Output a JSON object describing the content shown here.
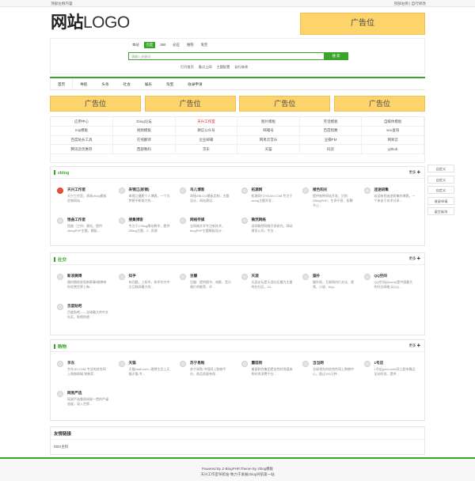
{
  "topbar": {
    "left": "顶部左侧内容",
    "right": "顶部右侧 | 自行修改"
  },
  "logo": {
    "cn": "网站",
    "en": "LOGO"
  },
  "ad_top": "广告位",
  "search": {
    "tabs": [
      "本站",
      "百度",
      "360",
      "必应",
      "搜狗",
      "淘宝"
    ],
    "active_tab": 1,
    "placeholder": "请输入关键词",
    "button": "搜 索",
    "hot": [
      "打开首页",
      "看点上网",
      "主题配置",
      "自行修改"
    ]
  },
  "nav": [
    "首页",
    "导航",
    "头条",
    "社会",
    "娱乐",
    "淘宝",
    "收录申请"
  ],
  "ads_row": [
    "广告位",
    "广告位",
    "广告位",
    "广告位"
  ],
  "links": [
    [
      "应用中心",
      "zblog论坛",
      "天兴工作室",
      "图片模板",
      "笑话模板",
      "自媒体模板"
    ],
    [
      "mip模板",
      "视频模板",
      "微信公众号",
      "邮箱号",
      "百度指数",
      "seo查询"
    ],
    [
      "百度站长工具",
      "在线翻译",
      "企业邮箱",
      "网易云音乐",
      "豆瓣FM",
      "网易云"
    ],
    [
      "腾讯云优惠券",
      "西部数码",
      "京东",
      "天猫",
      "码云",
      "github"
    ]
  ],
  "sidebar": [
    "自定义",
    "自定义",
    "自定义",
    "收录申请",
    "留言板块"
  ],
  "categories": [
    {
      "title": "zblog",
      "more": "更多 ✚",
      "items": [
        {
          "name": "天兴工作室",
          "desc": "天兴工作室，承接zblog模板定制网站..."
        },
        {
          "name": "来锦江(彩钢)",
          "desc": "来锦江摄影个人博客，一个为梦想不断努力的..."
        },
        {
          "name": "鸟儿博客",
          "desc": "承接ZBLOG模板定制，主题设计，网站建设..."
        },
        {
          "name": "拓源网",
          "desc": "拓源网TOYEAN.COM,专注于zblog主题开发..."
        },
        {
          "name": "橙色阳光",
          "desc": "提供各种网站开发、识别ZBlogPHP、生命不息、折腾不止..."
        },
        {
          "name": "迷途研集",
          "desc": "欢迎来到迷途研集的博客，一个来自于技术分享..."
        },
        {
          "name": "悟曲工作室",
          "desc": "悟曲（工作）建站，提供zblogPHP主题，模板..."
        },
        {
          "name": "搜集博客",
          "desc": "专注于Z-Blog建站教学，提供ZBlog主题、Z...资源"
        },
        {
          "name": "网络传媒",
          "desc": "全网络文学专注新技术，blogPHP主题模板设计..."
        },
        {
          "name": "微然网络",
          "desc": "深圳微然网络开发研究，网站建设公司，专业..."
        }
      ]
    },
    {
      "title": "社交",
      "more": "更多 ✚",
      "items": [
        {
          "name": "新浪微博",
          "desc": "随时随地发现新鲜事!微博带你欣赏世界上每..."
        },
        {
          "name": "知乎",
          "desc": "有问题，上知乎。知乎作为中文互联网最大的..."
        },
        {
          "name": "豆瓣",
          "desc": "豆瓣：提供图书、电影、音乐唱片的推荐、评..."
        },
        {
          "name": "天涯",
          "desc": "天涯论坛是天涯社区最为主要的在社区，24..."
        },
        {
          "name": "猫扑",
          "desc": "猫扑网，互联网内行文化、视频、小说、blyy..."
        },
        {
          "name": "QQ空间",
          "desc": "QQ空间(Qzone)是中国最大的社交网络,玩QQ..."
        },
        {
          "name": "百度贴吧",
          "desc": "百度贴吧——全球最大的中文社区。贴吧的使..."
        }
      ]
    },
    {
      "title": "购物",
      "more": "更多 ✚",
      "items": [
        {
          "name": "京东",
          "desc": "京东JD.COM-专业的综合网上购物商城,销售家..."
        },
        {
          "name": "天猫",
          "desc": "天猫tmall.com--理想生活上天猫天猫-专..."
        },
        {
          "name": "苏宁易购",
          "desc": "苏宁易购-中国网上购物平台，商品质量有保..."
        },
        {
          "name": "蘑菇街",
          "desc": "美丽联合集团是女性时尚媒体和时尚消费平台..."
        },
        {
          "name": "当当网",
          "desc": "全球领先的综合性网上购物中心。超过100万种..."
        },
        {
          "name": "1号店",
          "desc": "1号店(yhd.com)网上超市舞品全站时尚，提供..."
        },
        {
          "name": "网易严选",
          "desc": "网易严选秉承网易一贯的严谨态度，深入世界..."
        }
      ]
    }
  ],
  "friend": {
    "title": "友情链接",
    "link": "DBS主机"
  },
  "footer": {
    "line1": "Powered By Z-BlogPHP,Theme By zblog模板",
    "line2": "天兴工作室导航站-致力于发展zblog导航第一站"
  }
}
